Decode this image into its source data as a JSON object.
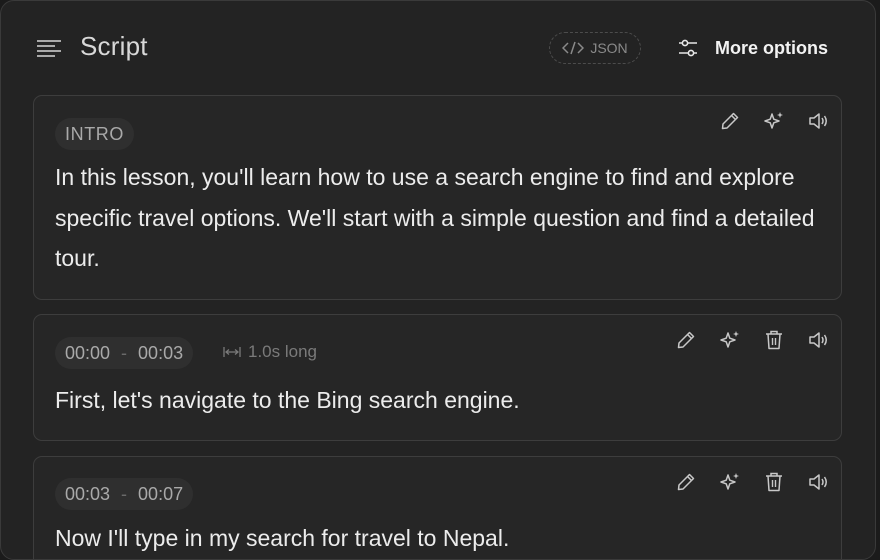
{
  "header": {
    "title": "Script",
    "json_label": "JSON",
    "more_options_label": "More options"
  },
  "segments": [
    {
      "tag": "INTRO",
      "text": "In this lesson, you'll learn how to use a search engine to find and explore specific travel options. We'll start with a simple question and find a detailed tour."
    },
    {
      "start": "00:00",
      "separator": "-",
      "end": "00:03",
      "duration": "1.0s long",
      "text": "First, let's navigate to the Bing search engine."
    },
    {
      "start": "00:03",
      "separator": "-",
      "end": "00:07",
      "text": "Now I'll type in my search for travel to Nepal."
    }
  ],
  "icons": {
    "menu": "menu-lines-icon",
    "json": "code-icon",
    "more": "sliders-icon",
    "edit": "pencil-icon",
    "ai": "sparkles-icon",
    "delete": "trash-icon",
    "audio": "speaker-icon",
    "duration": "expand-horizontal-icon"
  }
}
